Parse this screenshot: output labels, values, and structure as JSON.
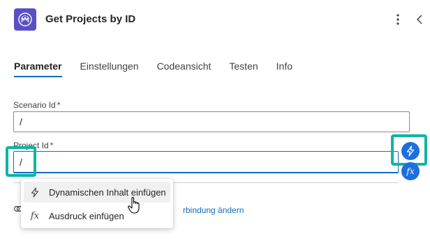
{
  "header": {
    "title": "Get Projects by ID",
    "logo_icon": "app-logo",
    "more_icon": "more-vertical-icon",
    "collapse_icon": "chevron-left-icon",
    "brand_color": "#5b4fc4"
  },
  "tabs": [
    {
      "label": "Parameter",
      "active": true
    },
    {
      "label": "Einstellungen",
      "active": false
    },
    {
      "label": "Codeansicht",
      "active": false
    },
    {
      "label": "Testen",
      "active": false
    },
    {
      "label": "Info",
      "active": false
    }
  ],
  "fields": {
    "scenario": {
      "label": "Scenario Id",
      "required_mark": "*",
      "value": "/"
    },
    "project": {
      "label": "Project Id",
      "required_mark": "*",
      "value": "/"
    }
  },
  "token_buttons": {
    "dynamic_icon": "lightning-icon",
    "expression_label": "fx",
    "accent_color": "#1d6fe0",
    "highlight_color": "#0fb4a5"
  },
  "connection": {
    "link_text": "rbindung ändern"
  },
  "context_menu": {
    "items": [
      {
        "label": "Dynamischen Inhalt einfügen",
        "icon": "lightning-icon"
      },
      {
        "label": "Ausdruck einfügen",
        "icon": "fx-icon",
        "icon_text": "fx"
      }
    ]
  }
}
